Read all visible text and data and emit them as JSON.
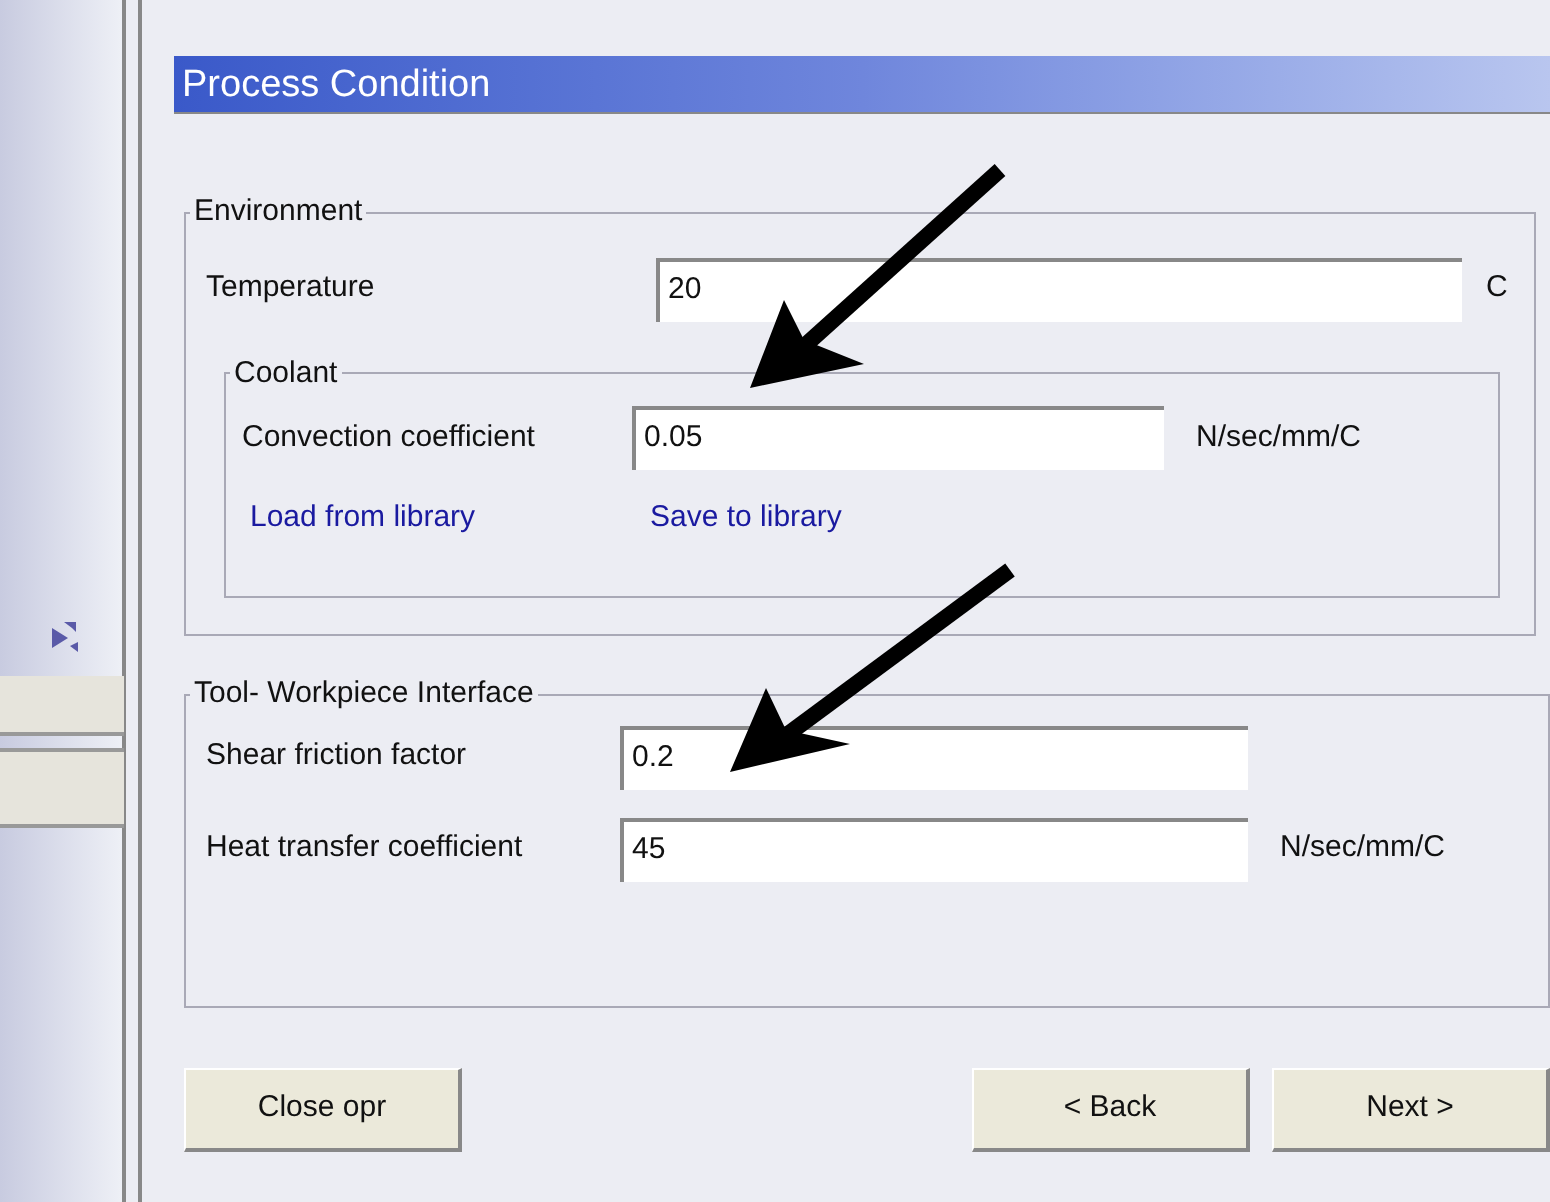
{
  "panel_title": "Process Condition",
  "environment": {
    "legend": "Environment",
    "temperature": {
      "label": "Temperature",
      "value": "20",
      "unit": "C"
    },
    "coolant": {
      "legend": "Coolant",
      "convection": {
        "label": "Convection coefficient",
        "value": "0.05",
        "unit": "N/sec/mm/C"
      },
      "links": [
        "Load from library",
        "Save to library"
      ]
    }
  },
  "interface": {
    "legend": "Tool- Workpiece Interface",
    "fields": [
      {
        "label": "Shear friction factor",
        "value": "0.2"
      },
      {
        "label": "Heat transfer coefficient",
        "value": "45",
        "unit": "N/sec/mm/C"
      }
    ]
  },
  "buttons": [
    {
      "label": "Close opr",
      "kind": "close"
    },
    {
      "label": "< Back",
      "kind": "back"
    },
    {
      "label": "Next >",
      "kind": "next"
    }
  ]
}
